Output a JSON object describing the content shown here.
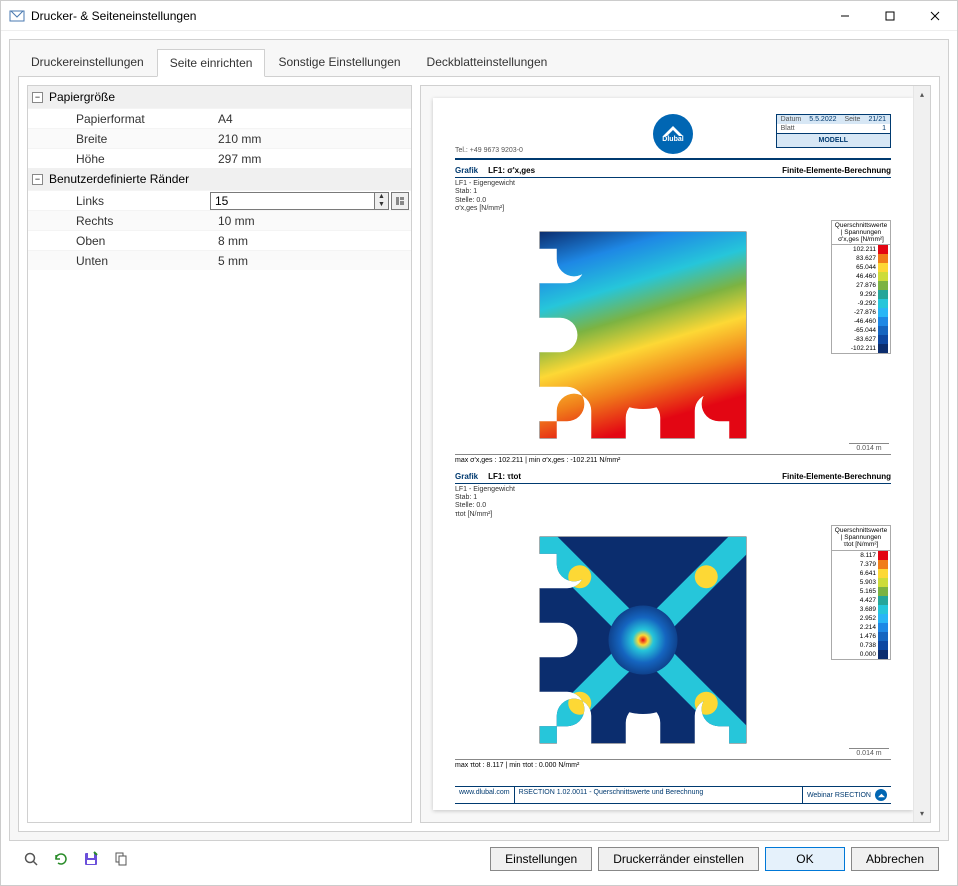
{
  "window": {
    "title": "Drucker- & Seiteneinstellungen"
  },
  "tabs": [
    {
      "id": "druckereinstellungen",
      "label": "Druckereinstellungen"
    },
    {
      "id": "seite-einrichten",
      "label": "Seite einrichten"
    },
    {
      "id": "sonstige-einstellungen",
      "label": "Sonstige Einstellungen"
    },
    {
      "id": "deckblatteinstellungen",
      "label": "Deckblatteinstellungen"
    }
  ],
  "active_tab": "seite-einrichten",
  "groups": {
    "papiergroesse": {
      "title": "Papiergröße",
      "items": {
        "papierformat": {
          "label": "Papierformat",
          "value": "A4"
        },
        "breite": {
          "label": "Breite",
          "value": "210 mm"
        },
        "hoehe": {
          "label": "Höhe",
          "value": "297 mm"
        }
      }
    },
    "raender": {
      "title": "Benutzerdefinierte Ränder",
      "items": {
        "links": {
          "label": "Links",
          "value": "15"
        },
        "rechts": {
          "label": "Rechts",
          "value": "10 mm"
        },
        "oben": {
          "label": "Oben",
          "value": "8 mm"
        },
        "unten": {
          "label": "Unten",
          "value": "5 mm"
        }
      }
    }
  },
  "report": {
    "tel": "Tel.: +49 9673 9203-0",
    "logo_text": "Dlubal",
    "meta": {
      "datum_label": "Datum",
      "datum_value": "5.5.2022",
      "seite_label": "Seite",
      "seite_value": "21/21",
      "blatt_label": "Blatt",
      "blatt_value": "1",
      "modell": "MODELL"
    },
    "grafik_label": "Grafik",
    "fe_label": "Finite-Elemente-Berechnung",
    "scale_label": "0.014 m",
    "charts": [
      {
        "title_lf": "LF1:",
        "title_var": "σ'x,ges",
        "info_line1": "LF1 - Eigengewicht",
        "info_line2": "Stab: 1",
        "info_line3": "Stelle: 0.0",
        "info_line4": "σ'x,ges [N/mm²]",
        "legend_header1": "Querschnittswerte",
        "legend_header2": "| Spannungen",
        "legend_header3": "σ'x,ges [N/mm²]",
        "footer": "max σ'x,ges : 102.211 | min σ'x,ges : -102.211 N/mm²"
      },
      {
        "title_lf": "LF1:",
        "title_var": "τtot",
        "info_line1": "LF1 - Eigengewicht",
        "info_line2": "Stab: 1",
        "info_line3": "Stelle: 0.0",
        "info_line4": "τtot [N/mm²]",
        "legend_header1": "Querschnittswerte",
        "legend_header2": "| Spannungen",
        "legend_header3": "τtot [N/mm²]",
        "footer": "max τtot : 8.117 | min τtot : 0.000 N/mm²"
      }
    ],
    "footer": {
      "url": "www.dlubal.com",
      "product": "RSECTION 1.02.0011 - Querschnittswerte und Berechnung",
      "webinar": "Webinar RSECTION"
    }
  },
  "chart_data": [
    {
      "type": "heatmap",
      "title": "LF1: σ'x,ges — Finite-Elemente-Berechnung",
      "unit": "N/mm²",
      "legend": [
        {
          "value": 102.211,
          "color": "#e30613"
        },
        {
          "value": 83.627,
          "color": "#f07d1a"
        },
        {
          "value": 65.044,
          "color": "#fdd835"
        },
        {
          "value": 46.46,
          "color": "#cddc39"
        },
        {
          "value": 27.876,
          "color": "#7cb342"
        },
        {
          "value": 9.292,
          "color": "#26a69a"
        },
        {
          "value": -9.292,
          "color": "#26c6da"
        },
        {
          "value": -27.876,
          "color": "#29b6f6"
        },
        {
          "value": -46.46,
          "color": "#1e88e5"
        },
        {
          "value": -65.044,
          "color": "#1565c0"
        },
        {
          "value": -83.627,
          "color": "#0d47a1"
        },
        {
          "value": -102.211,
          "color": "#0b2d6e"
        }
      ],
      "range": [
        -102.211,
        102.211
      ],
      "max": 102.211,
      "min": -102.211,
      "scale_bar": "0.014 m"
    },
    {
      "type": "heatmap",
      "title": "LF1: τtot — Finite-Elemente-Berechnung",
      "unit": "N/mm²",
      "legend": [
        {
          "value": 8.117,
          "color": "#e30613"
        },
        {
          "value": 7.379,
          "color": "#f07d1a"
        },
        {
          "value": 6.641,
          "color": "#fdd835"
        },
        {
          "value": 5.903,
          "color": "#cddc39"
        },
        {
          "value": 5.165,
          "color": "#7cb342"
        },
        {
          "value": 4.427,
          "color": "#26a69a"
        },
        {
          "value": 3.689,
          "color": "#26c6da"
        },
        {
          "value": 2.952,
          "color": "#29b6f6"
        },
        {
          "value": 2.214,
          "color": "#1e88e5"
        },
        {
          "value": 1.476,
          "color": "#1565c0"
        },
        {
          "value": 0.738,
          "color": "#0d47a1"
        },
        {
          "value": 0.0,
          "color": "#0b2d6e"
        }
      ],
      "range": [
        0.0,
        8.117
      ],
      "max": 8.117,
      "min": 0.0,
      "scale_bar": "0.014 m"
    }
  ],
  "buttons": {
    "einstellungen": "Einstellungen",
    "druckerraender": "Druckerränder einstellen",
    "ok": "OK",
    "abbrechen": "Abbrechen"
  }
}
